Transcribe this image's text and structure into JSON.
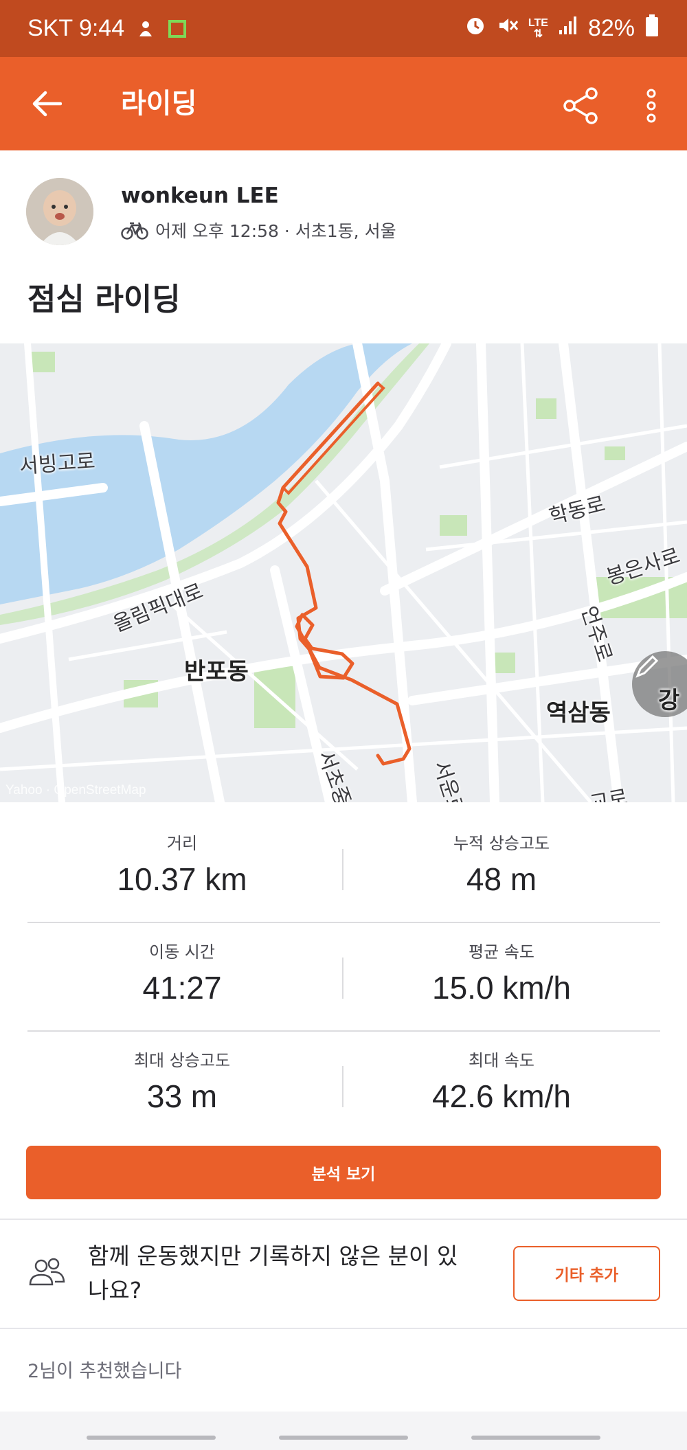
{
  "status_bar": {
    "carrier_time": "SKT 9:44",
    "battery": "82%",
    "network": "LTE"
  },
  "app_bar": {
    "title": "라이딩"
  },
  "activity": {
    "athlete_name": "wonkeun LEE",
    "meta": "어제 오후 12:58 · 서초1동, 서울",
    "title": "점심 라이딩"
  },
  "map": {
    "labels": {
      "seobinggo": "서빙고로",
      "olympic": "올림픽대로",
      "banpo": "반포동",
      "hakdong": "학동로",
      "bongeunsa": "봉은사로",
      "eonju": "언주로",
      "yeoksam": "역삼동",
      "seocho": "서초중",
      "seoun": "서운로",
      "gangnam": "강",
      "bottom_right": "교로"
    },
    "attribution": "Yahoo · OpenStreetMap",
    "route_color": "#ea5f2a"
  },
  "stats": [
    {
      "label": "거리",
      "value": "10.37 km"
    },
    {
      "label": "누적 상승고도",
      "value": "48 m"
    },
    {
      "label": "이동 시간",
      "value": "41:27"
    },
    {
      "label": "평균 속도",
      "value": "15.0 km/h"
    },
    {
      "label": "최대 상승고도",
      "value": "33 m"
    },
    {
      "label": "최대 속도",
      "value": "42.6 km/h"
    }
  ],
  "analysis_button": "분석 보기",
  "group_prompt": "함께 운동했지만 기록하지 않은 분이 있나요?",
  "add_others_button": "기타 추가",
  "kudos_text": "2님이 추천했습니다",
  "colors": {
    "accent": "#ea5f2a",
    "status_bar": "#c04a1f"
  }
}
